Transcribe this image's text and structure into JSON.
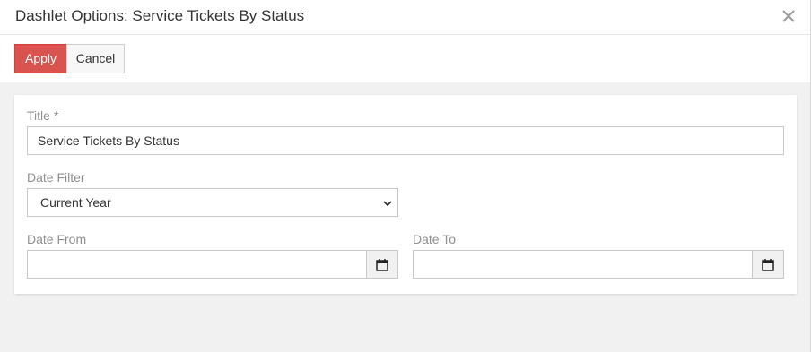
{
  "dialog": {
    "title": "Dashlet Options: Service Tickets By Status",
    "close_icon": "close-icon"
  },
  "toolbar": {
    "apply_label": "Apply",
    "cancel_label": "Cancel"
  },
  "form": {
    "title_label": "Title *",
    "title_value": "Service Tickets By Status",
    "date_filter_label": "Date Filter",
    "date_filter_value": "Current Year",
    "date_from_label": "Date From",
    "date_from_value": "",
    "date_to_label": "Date To",
    "date_to_value": "",
    "calendar_icon": "calendar-icon"
  },
  "colors": {
    "apply_bg": "#d9534f",
    "background": "#f1f1f1",
    "label": "#8f8f8f"
  }
}
